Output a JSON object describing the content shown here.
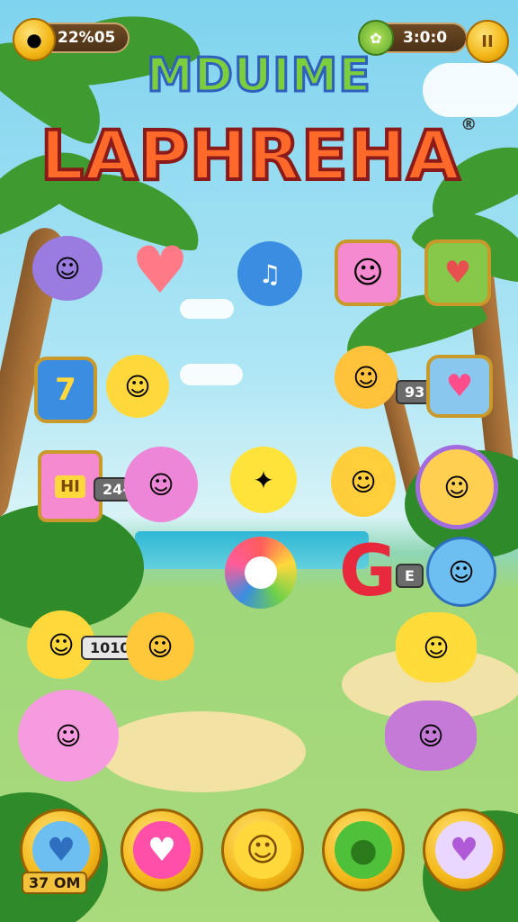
{
  "hud": {
    "score_text": "22%05",
    "timer_text": "3:0:0",
    "pause_label": "II"
  },
  "title": {
    "line1": "MDUIME",
    "line2": "LAPHREHA",
    "mark": "®"
  },
  "board": {
    "badge_7": "7",
    "badge_93": "93",
    "badge_24": "24-",
    "jar_label": "HI",
    "badge_g": "G",
    "badge_e": "E",
    "badge_1010": "1010"
  },
  "bottom_bar": {
    "timer_text": "37 OM"
  },
  "colors": {
    "accent_gold": "#f4b718",
    "title_blue_outline": "#2f5fbf",
    "title_red": "#ff6a2a",
    "pink": "#f58ad0",
    "yellow": "#ffd93b"
  },
  "icons": {
    "score": "coin-icon",
    "timer": "leaf-icon",
    "pause": "pause-icon"
  }
}
